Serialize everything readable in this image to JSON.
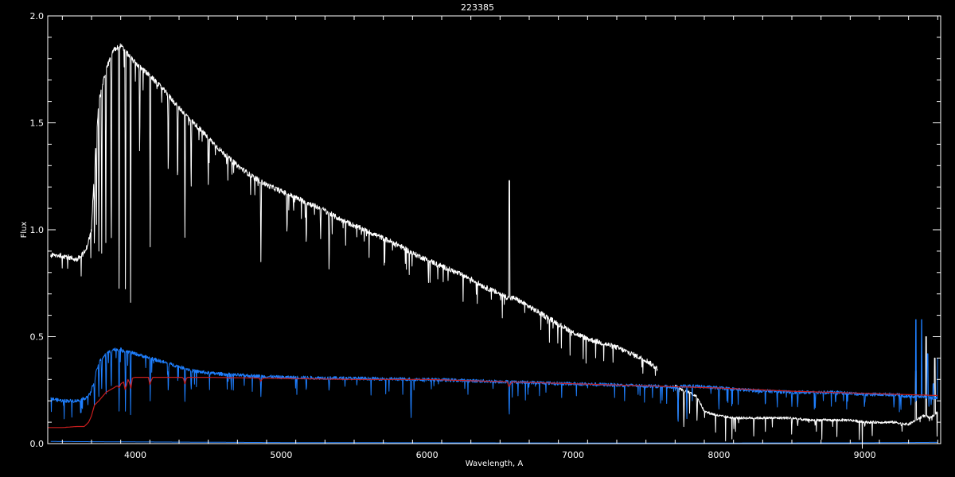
{
  "chart_data": {
    "type": "line",
    "title": "223385",
    "xlabel": "Wavelength, A",
    "ylabel": "Flux",
    "xlim": [
      3400,
      9520
    ],
    "ylim": [
      0,
      2
    ],
    "xticks": [
      4000,
      5000,
      6000,
      7000,
      8000,
      9000
    ],
    "yticks": [
      0.0,
      0.5,
      1.0,
      1.5,
      2.0
    ],
    "ytick_labels": [
      "0.0",
      "0.5",
      "1.0",
      "1.5",
      "2.0"
    ],
    "grid": false,
    "colors": {
      "background": "#000000",
      "axes": "#ffffff",
      "observed": "#ffffff",
      "model": "#1e7fff",
      "continuum": "#c81e1e",
      "error": "#1e7fff"
    },
    "series": [
      {
        "key": "observed",
        "x": [
          3420,
          3500,
          3600,
          3660,
          3700,
          3720,
          3750,
          3800,
          3850,
          3900,
          3950,
          4000,
          4100,
          4200,
          4300,
          4400,
          4500,
          4600,
          4700,
          4800,
          4900,
          5000,
          5100,
          5200,
          5300,
          5400,
          5500,
          5600,
          5700,
          5800,
          5900,
          6000,
          6100,
          6200,
          6300,
          6400,
          6500,
          6560,
          6600,
          6700,
          6800,
          6900,
          7000,
          7100,
          7200,
          7300,
          7400,
          7500,
          7580
        ],
        "y": [
          0.88,
          0.88,
          0.86,
          0.9,
          1.0,
          1.3,
          1.6,
          1.75,
          1.84,
          1.86,
          1.82,
          1.78,
          1.72,
          1.65,
          1.57,
          1.5,
          1.43,
          1.36,
          1.3,
          1.25,
          1.21,
          1.18,
          1.15,
          1.12,
          1.09,
          1.05,
          1.02,
          0.99,
          0.96,
          0.93,
          0.89,
          0.86,
          0.83,
          0.8,
          0.77,
          0.73,
          0.7,
          0.68,
          0.68,
          0.64,
          0.6,
          0.56,
          0.52,
          0.49,
          0.47,
          0.45,
          0.42,
          0.39,
          0.35
        ],
        "absorption": [
          [
            3720,
            0.85
          ],
          [
            3734,
            0.95
          ],
          [
            3750,
            0.9
          ],
          [
            3770,
            0.85
          ],
          [
            3798,
            0.85
          ],
          [
            3835,
            0.75
          ],
          [
            3889,
            0.6
          ],
          [
            3933,
            0.6
          ],
          [
            3968,
            0.6
          ],
          [
            4030,
            1.3
          ],
          [
            4102,
            0.92
          ],
          [
            4226,
            1.2
          ],
          [
            4290,
            1.15
          ],
          [
            4340,
            0.9
          ],
          [
            4383,
            1.15
          ],
          [
            4500,
            1.2
          ],
          [
            4861,
            0.85
          ],
          [
            5040,
            0.95
          ],
          [
            5172,
            0.9
          ],
          [
            5270,
            0.95
          ],
          [
            5328,
            0.77
          ],
          [
            5900,
            0.9
          ],
          [
            6563,
            0.72
          ],
          [
            6870,
            0.6
          ],
          [
            7600,
            0.33
          ]
        ],
        "emission": [
          [
            5895,
            0.55
          ],
          [
            6563,
            1.23
          ]
        ]
      },
      {
        "key": "observed_red",
        "x": [
          7700,
          7750,
          7800,
          7850,
          7900,
          8000,
          8100,
          8200,
          8300,
          8400,
          8500,
          8600,
          8700,
          8800,
          8900,
          9000,
          9100,
          9200,
          9300,
          9350,
          9400,
          9450,
          9500
        ],
        "y": [
          0.27,
          0.25,
          0.24,
          0.22,
          0.15,
          0.13,
          0.12,
          0.12,
          0.12,
          0.12,
          0.12,
          0.11,
          0.11,
          0.11,
          0.11,
          0.1,
          0.1,
          0.1,
          0.09,
          0.11,
          0.13,
          0.12,
          0.15
        ],
        "absorption": [
          [
            7720,
            0.1
          ],
          [
            7760,
            0.05
          ],
          [
            7850,
            0.1
          ],
          [
            8500,
            0.08
          ],
          [
            8540,
            0.08
          ],
          [
            8660,
            0.08
          ],
          [
            9000,
            0.08
          ],
          [
            9250,
            0.08
          ]
        ],
        "emission": [
          [
            9350,
            0.34
          ],
          [
            9420,
            0.5
          ],
          [
            9480,
            0.4
          ]
        ]
      },
      {
        "key": "model",
        "x": [
          3420,
          3500,
          3600,
          3650,
          3690,
          3720,
          3750,
          3800,
          3850,
          3900,
          3950,
          4000,
          4100,
          4200,
          4300,
          4400,
          4500,
          4700,
          5000,
          5500,
          6000,
          6500,
          7000,
          7500,
          7700,
          7800,
          8000,
          8200,
          8500,
          8800,
          9000,
          9200,
          9300,
          9400,
          9500
        ],
        "y": [
          0.21,
          0.2,
          0.2,
          0.21,
          0.23,
          0.3,
          0.38,
          0.42,
          0.44,
          0.44,
          0.43,
          0.42,
          0.4,
          0.38,
          0.36,
          0.34,
          0.33,
          0.32,
          0.31,
          0.305,
          0.3,
          0.29,
          0.28,
          0.27,
          0.265,
          0.27,
          0.26,
          0.25,
          0.24,
          0.24,
          0.23,
          0.23,
          0.22,
          0.22,
          0.21
        ],
        "absorption": [
          [
            3720,
            0.15
          ],
          [
            3750,
            0.22
          ],
          [
            3770,
            0.25
          ],
          [
            3800,
            0.2
          ],
          [
            3835,
            0.23
          ],
          [
            3889,
            0.12
          ],
          [
            3933,
            0.12
          ],
          [
            3968,
            0.12
          ],
          [
            4102,
            0.2
          ],
          [
            4226,
            0.22
          ],
          [
            4340,
            0.18
          ],
          [
            4383,
            0.24
          ],
          [
            4861,
            0.22
          ],
          [
            5172,
            0.24
          ],
          [
            5328,
            0.24
          ],
          [
            5890,
            0.09
          ],
          [
            6563,
            0.1
          ],
          [
            7720,
            0.05
          ],
          [
            7780,
            0.1
          ],
          [
            8000,
            0.15
          ],
          [
            8500,
            0.17
          ],
          [
            8540,
            0.16
          ],
          [
            8660,
            0.16
          ],
          [
            8800,
            0.18
          ],
          [
            9000,
            0.18
          ],
          [
            9200,
            0.16
          ],
          [
            9350,
            0.1
          ]
        ],
        "emission": [
          [
            9350,
            0.58
          ],
          [
            9390,
            0.58
          ],
          [
            9430,
            0.42
          ],
          [
            9470,
            0.28
          ],
          [
            9500,
            0.4
          ]
        ]
      },
      {
        "key": "continuum",
        "x": [
          3400,
          3500,
          3600,
          3650,
          3680,
          3700,
          3720,
          3750,
          3800,
          3850,
          3900,
          3950,
          4000,
          4200,
          4500,
          5000,
          5500,
          6000,
          6500,
          7000,
          7500,
          8000,
          8500,
          9000,
          9500
        ],
        "y": [
          0.075,
          0.075,
          0.08,
          0.08,
          0.1,
          0.13,
          0.18,
          0.2,
          0.24,
          0.26,
          0.28,
          0.3,
          0.31,
          0.31,
          0.31,
          0.305,
          0.3,
          0.3,
          0.29,
          0.28,
          0.27,
          0.26,
          0.245,
          0.235,
          0.225
        ],
        "absorption": [
          [
            3889,
            0.26
          ],
          [
            3933,
            0.24
          ],
          [
            3968,
            0.25
          ],
          [
            4102,
            0.27
          ],
          [
            4340,
            0.28
          ],
          [
            4861,
            0.29
          ],
          [
            6563,
            0.26
          ]
        ]
      },
      {
        "key": "error",
        "x": [
          3420,
          4000,
          5000,
          6000,
          7000,
          8000,
          9000,
          9500
        ],
        "y": [
          0.01,
          0.008,
          0.005,
          0.004,
          0.003,
          0.003,
          0.004,
          0.006
        ],
        "absorption": [],
        "emission": []
      }
    ]
  }
}
